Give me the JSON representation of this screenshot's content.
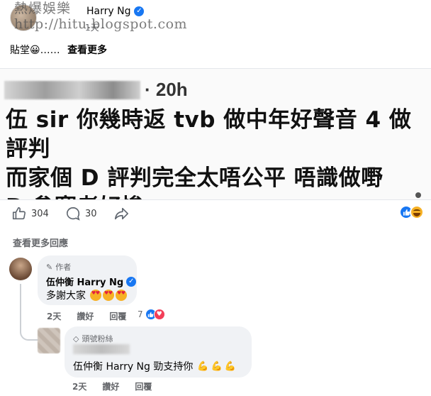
{
  "header": {
    "author": "Harry Ng",
    "time": "1天",
    "privacy_icon": "globe-icon",
    "watermark_line1": "熱爆娛樂",
    "watermark_line2": "http://hitu.blogspot.com",
    "caption": "貼堂😀……",
    "see_more": "查看更多"
  },
  "embedded_post": {
    "time": "· 20h",
    "lines": [
      "伍 sir 你幾時返 tvb 做中年好聲音 4 做評判",
      "而家個 D 評判完全太唔公平  唔識做嘢",
      "D 參賽者好慘"
    ]
  },
  "actions": {
    "like_count": "304",
    "comment_count": "30",
    "reactions": [
      "like-icon",
      "haha-icon"
    ]
  },
  "view_more_comments": "查看更多回應",
  "comments": [
    {
      "badge": "作者",
      "badge_icon": "pencil-icon",
      "name": "伍仲衡 Harry Ng",
      "text": "多謝大家",
      "emojis": [
        "heart-eyes-emoji",
        "heart-eyes-emoji",
        "heart-eyes-emoji"
      ],
      "time": "2天",
      "like": "讚好",
      "reply": "回覆",
      "reaction_count": "7"
    },
    {
      "badge": "頭號粉絲",
      "badge_icon": "diamond-icon",
      "text": "伍仲衡 Harry Ng 勁支持你",
      "emojis": [
        "flexed-biceps-emoji",
        "flexed-biceps-emoji",
        "flexed-biceps-emoji"
      ],
      "time": "2天",
      "like": "讚好",
      "reply": "回覆"
    }
  ],
  "colors": {
    "accent": "#1877f2",
    "bubble": "#f0f2f5",
    "secondary_text": "#65676b",
    "love": "#f33e58",
    "haha": "#f7b125"
  }
}
